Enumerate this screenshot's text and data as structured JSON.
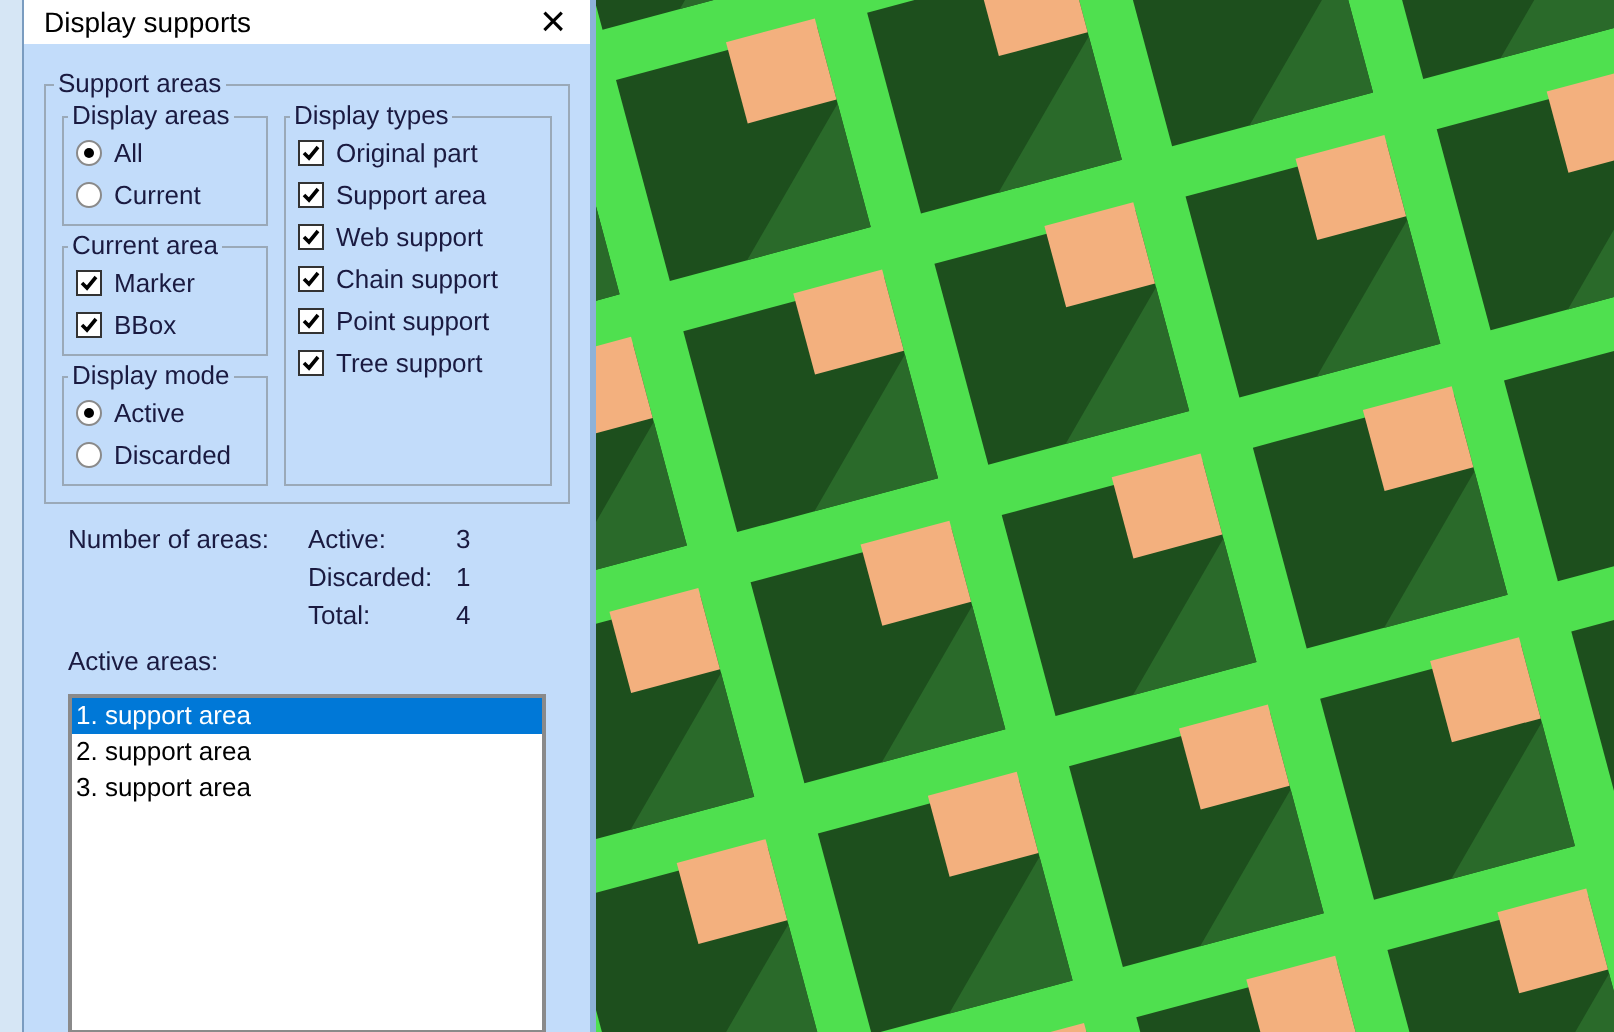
{
  "window": {
    "title": "Display supports",
    "close": "×"
  },
  "support_areas": {
    "label": "Support areas",
    "display_areas": {
      "label": "Display areas",
      "options": [
        {
          "label": "All",
          "selected": true
        },
        {
          "label": "Current",
          "selected": false
        }
      ]
    },
    "current_area": {
      "label": "Current area",
      "items": [
        {
          "label": "Marker",
          "checked": true
        },
        {
          "label": "BBox",
          "checked": true
        }
      ]
    },
    "display_mode": {
      "label": "Display mode",
      "options": [
        {
          "label": "Active",
          "selected": true
        },
        {
          "label": "Discarded",
          "selected": false
        }
      ]
    },
    "display_types": {
      "label": "Display types",
      "items": [
        {
          "label": "Original part",
          "checked": true
        },
        {
          "label": "Support area",
          "checked": true
        },
        {
          "label": "Web support",
          "checked": true
        },
        {
          "label": "Chain support",
          "checked": true
        },
        {
          "label": "Point support",
          "checked": true
        },
        {
          "label": "Tree support",
          "checked": true
        }
      ]
    }
  },
  "counts": {
    "label": "Number of areas:",
    "rows": [
      {
        "label": "Active:",
        "value": "3"
      },
      {
        "label": "Discarded:",
        "value": "1"
      },
      {
        "label": "Total:",
        "value": "4"
      }
    ]
  },
  "active_areas": {
    "label": "Active areas:",
    "items": [
      {
        "label": "1. support area",
        "selected": true
      },
      {
        "label": "2. support area",
        "selected": false
      },
      {
        "label": "3. support area",
        "selected": false
      }
    ]
  }
}
